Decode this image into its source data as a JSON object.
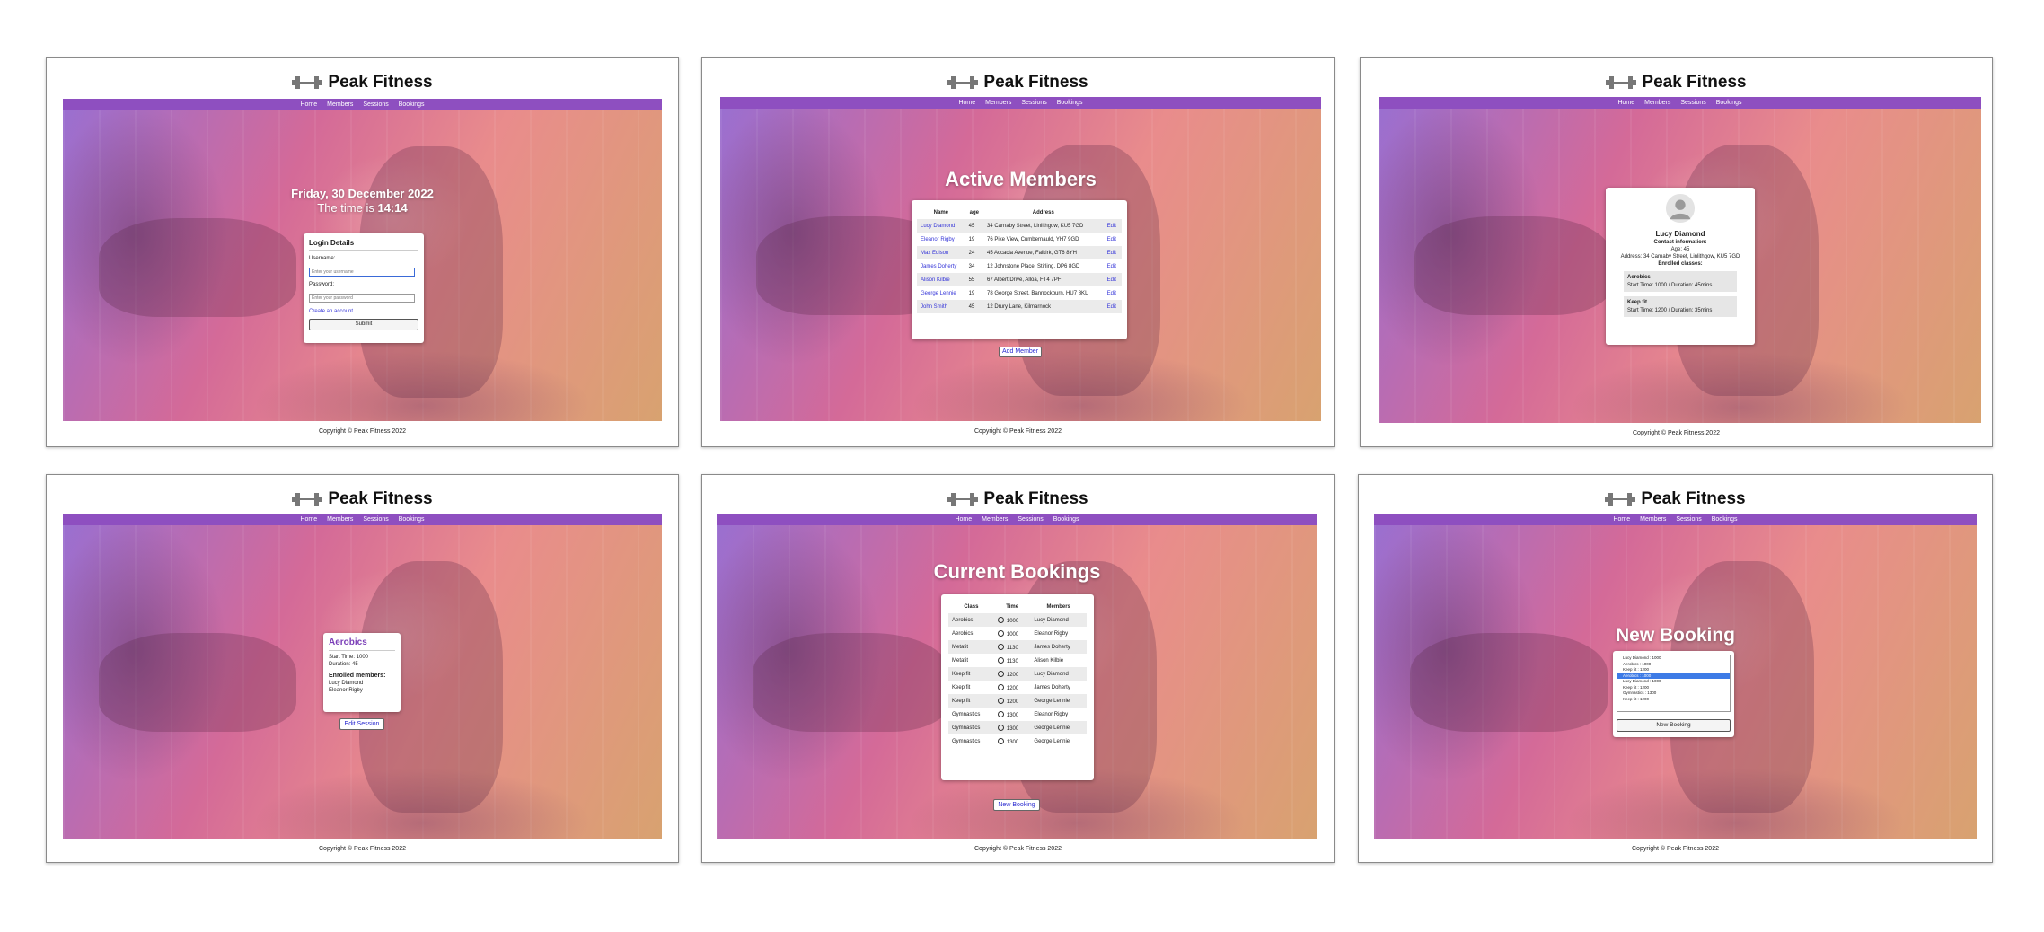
{
  "site": {
    "title": "Peak Fitness",
    "nav": [
      "Home",
      "Members",
      "Sessions",
      "Bookings"
    ],
    "footer": "Copyright © Peak Fitness 2022",
    "accent": "#8e4fc0"
  },
  "home": {
    "date": "Friday, 30 December 2022",
    "time_prefix": "The time is",
    "time": "14:14",
    "login": {
      "heading": "Login Details",
      "username_label": "Username:",
      "username_placeholder": "Enter your username",
      "password_label": "Password:",
      "password_placeholder": "Enter your password",
      "create_link": "Create an account",
      "submit": "Submit"
    }
  },
  "members": {
    "title": "Active Members",
    "columns": [
      "Name",
      "age",
      "Address",
      ""
    ],
    "rows": [
      {
        "name": "Lucy Diamond",
        "age": "45",
        "address": "34 Carnaby Street, Linlithgow, KU5 7GD",
        "action": "Edit"
      },
      {
        "name": "Eleanor Rigby",
        "age": "19",
        "address": "76 Pike View, Cumbernauld, YH7 9GD",
        "action": "Edit"
      },
      {
        "name": "Max Edison",
        "age": "24",
        "address": "45 Accacia Avenue, Falkirk, GT6 8YH",
        "action": "Edit"
      },
      {
        "name": "James Doherty",
        "age": "34",
        "address": "12 Johnstone Place, Stirling, DP6 8GD",
        "action": "Edit"
      },
      {
        "name": "Alison Kilbie",
        "age": "55",
        "address": "67 Albert Drive, Alloa, FT4 7PF",
        "action": "Edit"
      },
      {
        "name": "George Lennie",
        "age": "19",
        "address": "78 George Street, Bannockburn, HU7 8KL",
        "action": "Edit"
      },
      {
        "name": "John Smith",
        "age": "45",
        "address": "12 Drury Lane, Kilmarnock",
        "action": "Edit"
      }
    ],
    "add_button": "Add Member"
  },
  "member_detail": {
    "name": "Lucy Diamond",
    "contact_heading": "Contact information:",
    "age_line": "Age: 45",
    "address_line": "Address: 34 Carnaby Street, Linlithgow, KU5 7GD",
    "classes_heading": "Enrolled classes:",
    "classes": [
      {
        "name": "Aerobics",
        "details": "Start Time: 1000 / Duration: 45mins"
      },
      {
        "name": "Keep fit",
        "details": "Start Time: 1200 / Duration: 35mins"
      }
    ]
  },
  "session": {
    "title": "Aerobics",
    "start": "Start Time: 1000",
    "duration": "Duration: 45",
    "enrolled_heading": "Enrolled members:",
    "members": [
      "Lucy Diamond",
      "Eleanor Rigby"
    ],
    "edit_button": "Edit Session"
  },
  "bookings": {
    "title": "Current Bookings",
    "columns": [
      "Class",
      "Time",
      "Members"
    ],
    "rows": [
      {
        "class": "Aerobics",
        "time": "1000",
        "member": "Lucy Diamond"
      },
      {
        "class": "Aerobics",
        "time": "1000",
        "member": "Eleanor Rigby"
      },
      {
        "class": "Metafit",
        "time": "1130",
        "member": "James Doherty"
      },
      {
        "class": "Metafit",
        "time": "1130",
        "member": "Alison Kilbie"
      },
      {
        "class": "Keep fit",
        "time": "1200",
        "member": "Lucy Diamond"
      },
      {
        "class": "Keep fit",
        "time": "1200",
        "member": "James Doherty"
      },
      {
        "class": "Keep fit",
        "time": "1200",
        "member": "George Lennie"
      },
      {
        "class": "Gymnastics",
        "time": "1300",
        "member": "Eleanor Rigby"
      },
      {
        "class": "Gymnastics",
        "time": "1300",
        "member": "George Lennie"
      },
      {
        "class": "Gymnastics",
        "time": "1300",
        "member": "George Lennie"
      }
    ],
    "new_button": "New Booking"
  },
  "new_booking": {
    "title": "New Booking",
    "options": [
      "Lucy Diamond : 1000",
      "Aerobics : 1000",
      "Keep fit : 1200",
      "Aerobics : 1000",
      "Lucy Diamond : 1000",
      "Keep fit : 1200",
      "Gymnastics : 1300",
      "Keep fit : 1200"
    ],
    "selected_index": 3,
    "submit": "New Booking"
  }
}
